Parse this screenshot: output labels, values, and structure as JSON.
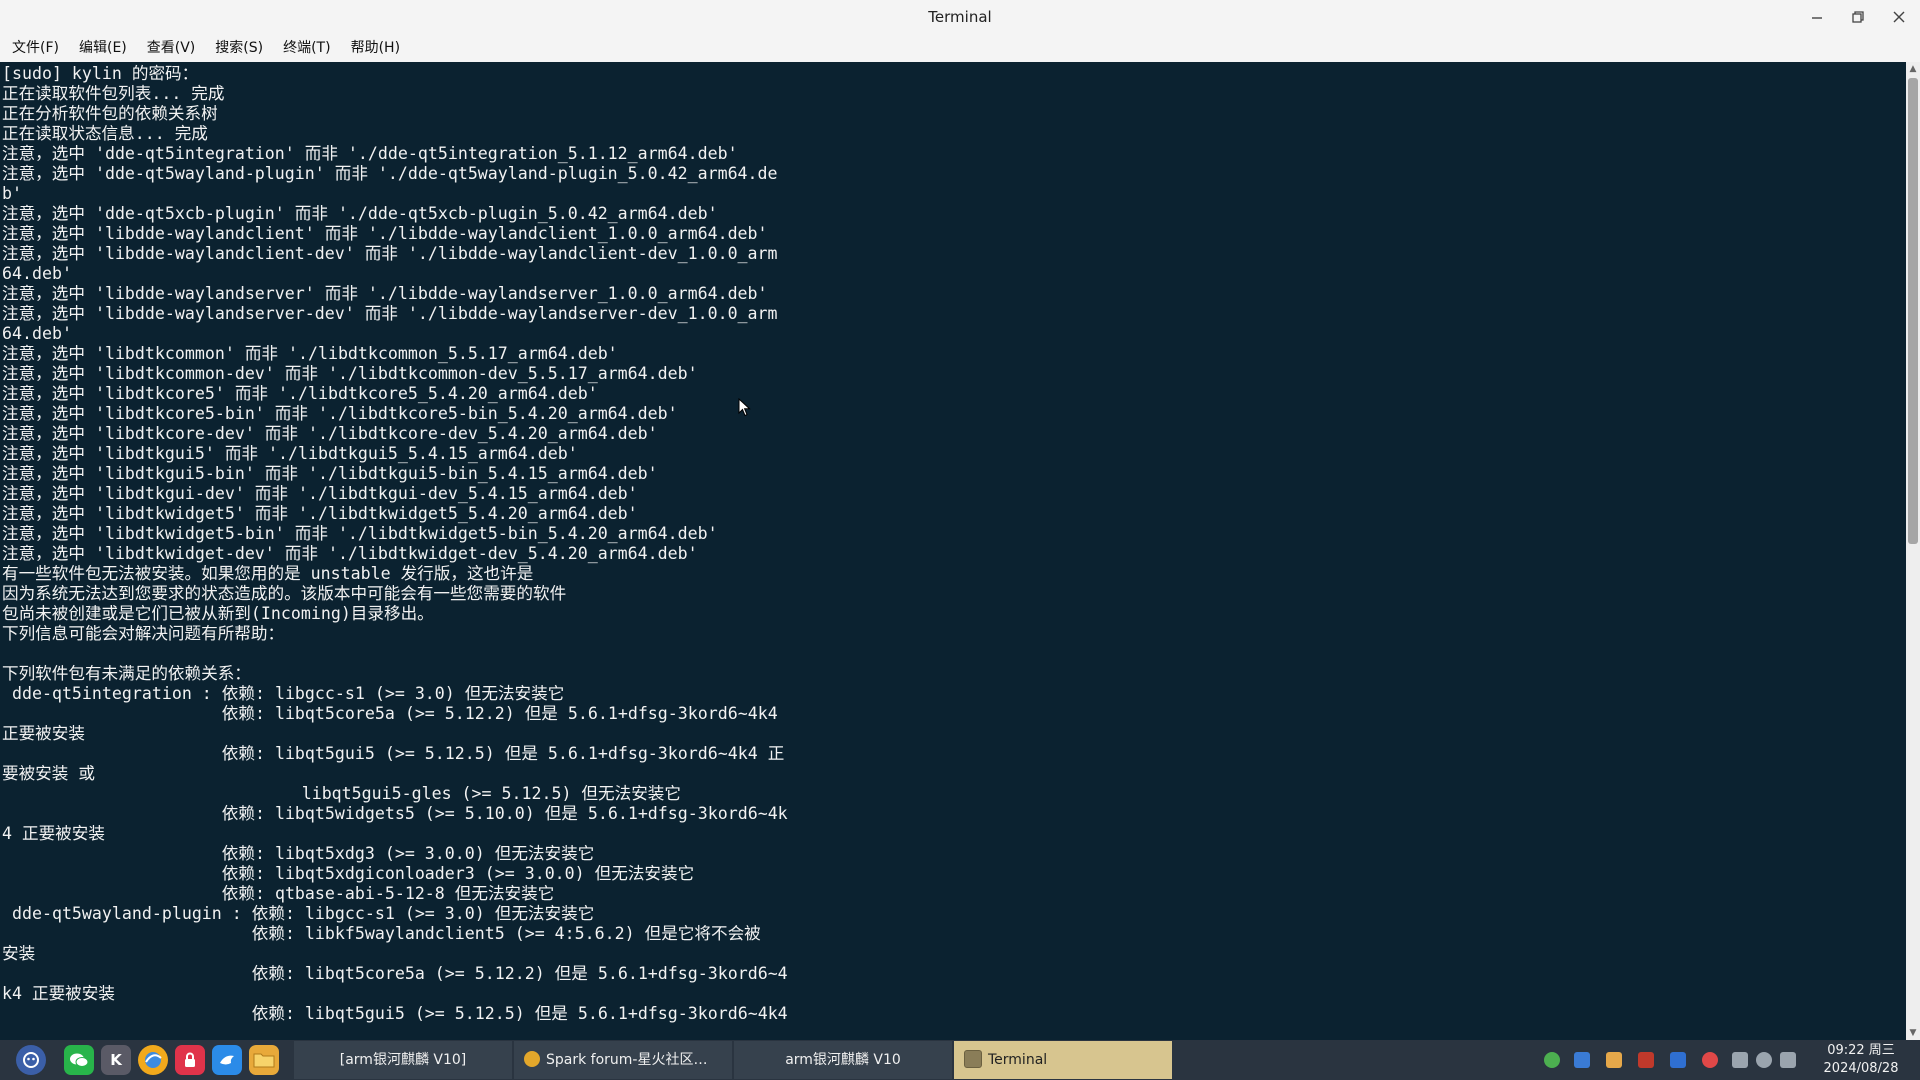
{
  "window": {
    "title": "Terminal"
  },
  "menu": [
    "文件(F)",
    "编辑(E)",
    "查看(V)",
    "搜索(S)",
    "终端(T)",
    "帮助(H)"
  ],
  "terminal_lines": [
    "[sudo] kylin 的密码：",
    "正在读取软件包列表... 完成",
    "正在分析软件包的依赖关系树",
    "正在读取状态信息... 完成",
    "注意，选中 'dde-qt5integration' 而非 './dde-qt5integration_5.1.12_arm64.deb'",
    "注意，选中 'dde-qt5wayland-plugin' 而非 './dde-qt5wayland-plugin_5.0.42_arm64.de",
    "b'",
    "注意，选中 'dde-qt5xcb-plugin' 而非 './dde-qt5xcb-plugin_5.0.42_arm64.deb'",
    "注意，选中 'libdde-waylandclient' 而非 './libdde-waylandclient_1.0.0_arm64.deb'",
    "注意，选中 'libdde-waylandclient-dev' 而非 './libdde-waylandclient-dev_1.0.0_arm",
    "64.deb'",
    "注意，选中 'libdde-waylandserver' 而非 './libdde-waylandserver_1.0.0_arm64.deb'",
    "注意，选中 'libdde-waylandserver-dev' 而非 './libdde-waylandserver-dev_1.0.0_arm",
    "64.deb'",
    "注意，选中 'libdtkcommon' 而非 './libdtkcommon_5.5.17_arm64.deb'",
    "注意，选中 'libdtkcommon-dev' 而非 './libdtkcommon-dev_5.5.17_arm64.deb'",
    "注意，选中 'libdtkcore5' 而非 './libdtkcore5_5.4.20_arm64.deb'",
    "注意，选中 'libdtkcore5-bin' 而非 './libdtkcore5-bin_5.4.20_arm64.deb'",
    "注意，选中 'libdtkcore-dev' 而非 './libdtkcore-dev_5.4.20_arm64.deb'",
    "注意，选中 'libdtkgui5' 而非 './libdtkgui5_5.4.15_arm64.deb'",
    "注意，选中 'libdtkgui5-bin' 而非 './libdtkgui5-bin_5.4.15_arm64.deb'",
    "注意，选中 'libdtkgui-dev' 而非 './libdtkgui-dev_5.4.15_arm64.deb'",
    "注意，选中 'libdtkwidget5' 而非 './libdtkwidget5_5.4.20_arm64.deb'",
    "注意，选中 'libdtkwidget5-bin' 而非 './libdtkwidget5-bin_5.4.20_arm64.deb'",
    "注意，选中 'libdtkwidget-dev' 而非 './libdtkwidget-dev_5.4.20_arm64.deb'",
    "有一些软件包无法被安装。如果您用的是 unstable 发行版，这也许是",
    "因为系统无法达到您要求的状态造成的。该版本中可能会有一些您需要的软件",
    "包尚未被创建或是它们已被从新到(Incoming)目录移出。",
    "下列信息可能会对解决问题有所帮助：",
    "",
    "下列软件包有未满足的依赖关系：",
    " dde-qt5integration : 依赖: libgcc-s1 (>= 3.0) 但无法安装它",
    "                      依赖: libqt5core5a (>= 5.12.2) 但是 5.6.1+dfsg-3kord6~4k4",
    "正要被安装",
    "                      依赖: libqt5gui5 (>= 5.12.5) 但是 5.6.1+dfsg-3kord6~4k4 正",
    "要被安装 或",
    "                              libqt5gui5-gles (>= 5.12.5) 但无法安装它",
    "                      依赖: libqt5widgets5 (>= 5.10.0) 但是 5.6.1+dfsg-3kord6~4k",
    "4 正要被安装",
    "                      依赖: libqt5xdg3 (>= 3.0.0) 但无法安装它",
    "                      依赖: libqt5xdgiconloader3 (>= 3.0.0) 但无法安装它",
    "                      依赖: qtbase-abi-5-12-8 但无法安装它",
    " dde-qt5wayland-plugin : 依赖: libgcc-s1 (>= 3.0) 但无法安装它",
    "                         依赖: libkf5waylandclient5 (>= 4:5.6.2) 但是它将不会被",
    "安装",
    "                         依赖: libqt5core5a (>= 5.12.2) 但是 5.6.1+dfsg-3kord6~4",
    "k4 正要被安装",
    "                         依赖: libqt5gui5 (>= 5.12.5) 但是 5.6.1+dfsg-3kord6~4k4"
  ],
  "taskbar": {
    "apps": [
      "launcher-icon",
      "wechat-icon",
      "kylin-k-icon",
      "browser-icon",
      "security-icon",
      "bird-icon",
      "file-manager-icon"
    ],
    "windows": [
      {
        "label": "[arm银河麒麟 V10]",
        "active": false
      },
      {
        "label": "Spark forum-星火社区…",
        "active": false
      },
      {
        "label": "arm银河麒麟 V10",
        "active": false
      },
      {
        "label": "Terminal",
        "active": true
      }
    ],
    "clock": {
      "time": "09:22 周三",
      "date": "2024/08/28"
    }
  }
}
